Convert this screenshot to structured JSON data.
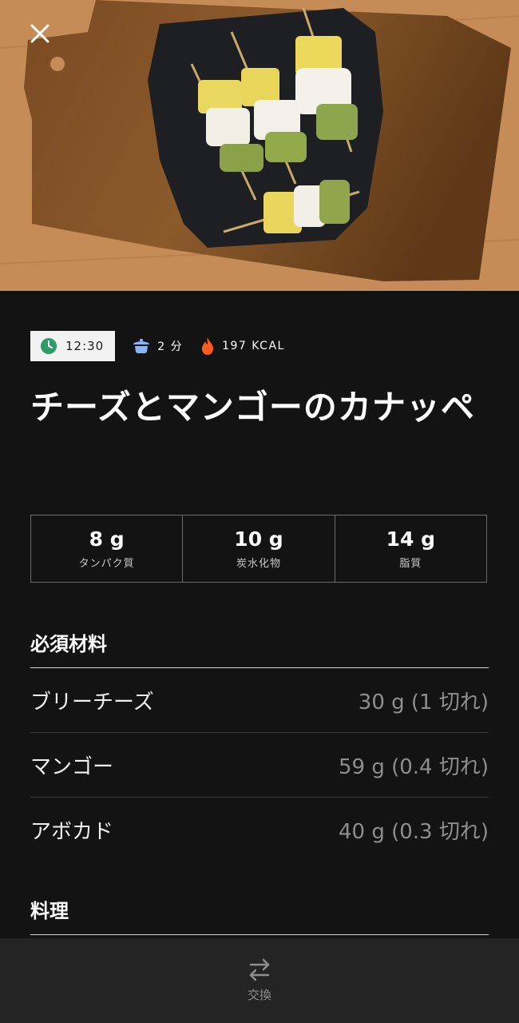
{
  "hero": {
    "close_icon": "close-icon",
    "image": "recipe-photo"
  },
  "meta": {
    "time": "12:30",
    "duration": "2 分",
    "calories": "197 KCAL",
    "icons": {
      "time": "clock-icon",
      "duration": "pot-icon",
      "calories": "flame-icon"
    },
    "colors": {
      "clock": "#2f9a6a",
      "pot": "#8ab4f8",
      "flame": "#ff5a1f"
    }
  },
  "recipe": {
    "title": "チーズとマンゴーのカナッペ"
  },
  "nutrition": [
    {
      "value": "8 g",
      "label": "タンパク質"
    },
    {
      "value": "10 g",
      "label": "炭水化物"
    },
    {
      "value": "14 g",
      "label": "脂質"
    }
  ],
  "ingredients": {
    "heading": "必須材料",
    "items": [
      {
        "name": "ブリーチーズ",
        "amount": "30 g (1 切れ)"
      },
      {
        "name": "マンゴー",
        "amount": "59 g (0.4 切れ)"
      },
      {
        "name": "アボカド",
        "amount": "40 g (0.3 切れ)"
      }
    ]
  },
  "cooking": {
    "heading": "料理"
  },
  "bottom_bar": {
    "swap_label": "交換",
    "swap_icon": "swap-icon"
  }
}
